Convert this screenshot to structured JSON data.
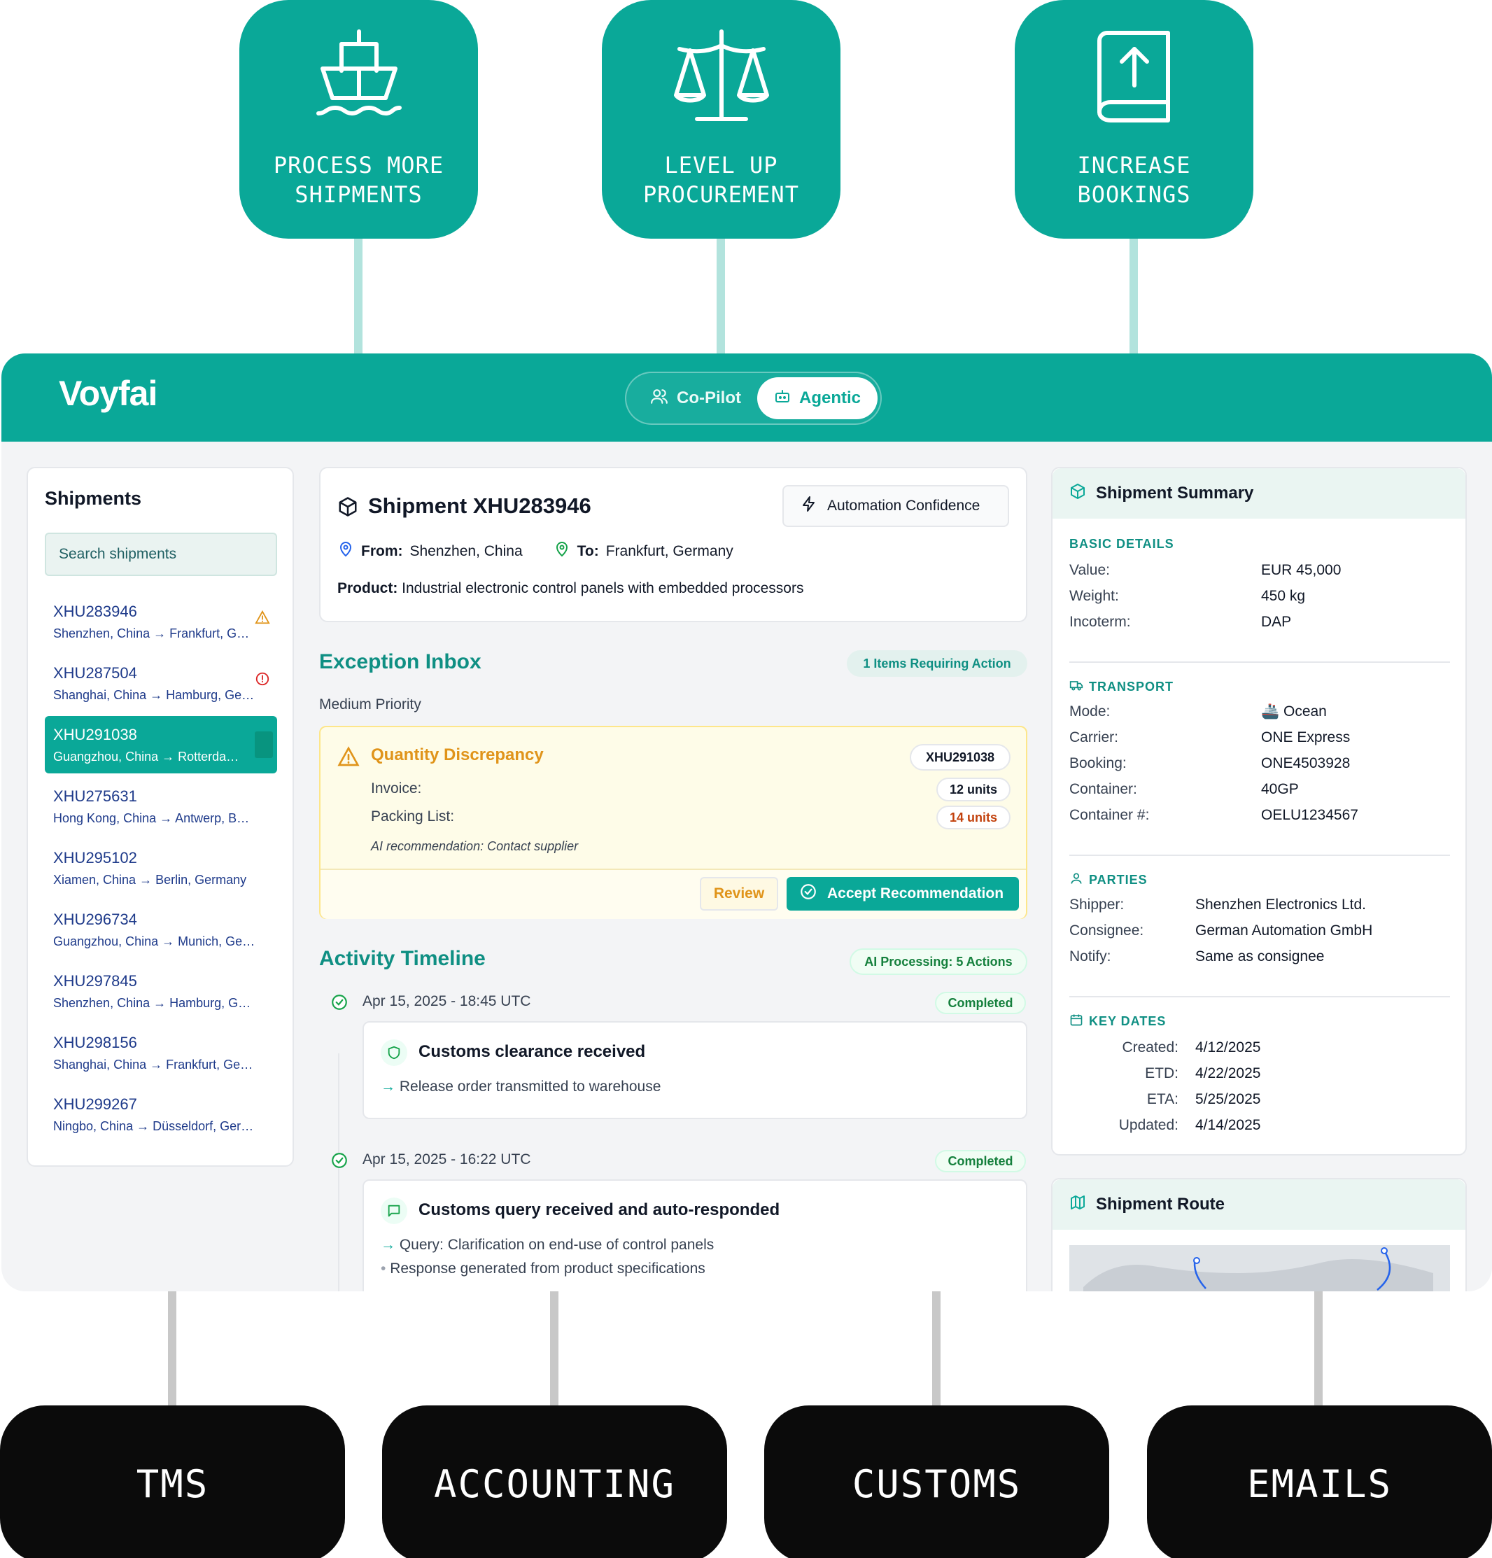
{
  "outcomes": [
    {
      "label": "PROCESS MORE\nSHIPMENTS",
      "icon": "ship-icon"
    },
    {
      "label": "LEVEL UP\nPROCUREMENT",
      "icon": "scales-icon"
    },
    {
      "label": "INCREASE\nBOOKINGS",
      "icon": "book-upload-icon"
    }
  ],
  "app": {
    "logo": "Voyfai",
    "modes": {
      "copilot": "Co-Pilot",
      "agentic": "Agentic",
      "selected": "Agentic"
    }
  },
  "shipments": {
    "title": "Shipments",
    "search_placeholder": "Search shipments",
    "items": [
      {
        "id": "XHU283946",
        "route": "Shenzhen, China → Frankfurt, Germany",
        "flag": "warning"
      },
      {
        "id": "XHU287504",
        "route": "Shanghai, China → Hamburg, Germany",
        "flag": "error"
      },
      {
        "id": "XHU291038",
        "route": "Guangzhou, China → Rotterdam, Netherlands",
        "flag": "selected"
      },
      {
        "id": "XHU275631",
        "route": "Hong Kong, China → Antwerp, Belgium",
        "flag": ""
      },
      {
        "id": "XHU295102",
        "route": "Xiamen, China → Berlin, Germany",
        "flag": ""
      },
      {
        "id": "XHU296734",
        "route": "Guangzhou, China → Munich, Germany",
        "flag": ""
      },
      {
        "id": "XHU297845",
        "route": "Shenzhen, China → Hamburg, Germany",
        "flag": ""
      },
      {
        "id": "XHU298156",
        "route": "Shanghai, China → Frankfurt, Germany",
        "flag": ""
      },
      {
        "id": "XHU299267",
        "route": "Ningbo, China → Düsseldorf, Germany",
        "flag": ""
      }
    ]
  },
  "shipment": {
    "title": "Shipment XHU283946",
    "automation_label": "Automation Confidence",
    "from_label": "From:",
    "from": "Shenzhen, China",
    "to_label": "To:",
    "to": "Frankfurt, Germany",
    "product_label": "Product:",
    "product": "Industrial electronic control panels with embedded processors"
  },
  "exceptions": {
    "title": "Exception Inbox",
    "badge": "1 Items Requiring Action",
    "priority": "Medium Priority",
    "card": {
      "title": "Quantity Discrepancy",
      "shipment_id": "XHU291038",
      "invoice_label": "Invoice:",
      "invoice_value": "12 units",
      "packing_label": "Packing List:",
      "packing_value": "14 units",
      "recommendation": "AI recommendation: Contact supplier",
      "review_label": "Review",
      "accept_label": "Accept Recommendation"
    }
  },
  "timeline": {
    "title": "Activity Timeline",
    "badge": "AI Processing: 5 Actions",
    "events": [
      {
        "time": "Apr 15, 2025 - 18:45 UTC",
        "status": "Completed",
        "title": "Customs clearance received",
        "details": [
          "Release order transmitted to warehouse"
        ],
        "icon": "shield-icon"
      },
      {
        "time": "Apr 15, 2025 - 16:22 UTC",
        "status": "Completed",
        "title": "Customs query received and auto-responded",
        "details": [
          "Query: Clarification on end-use of control panels",
          "Response generated from product specifications"
        ],
        "icon": "chat-icon"
      }
    ]
  },
  "summary": {
    "title": "Shipment Summary",
    "basic": {
      "heading": "BASIC DETAILS",
      "rows": [
        [
          "Value:",
          "EUR 45,000"
        ],
        [
          "Weight:",
          "450 kg"
        ],
        [
          "Incoterm:",
          "DAP"
        ]
      ]
    },
    "transport": {
      "heading": "TRANSPORT",
      "rows": [
        [
          "Mode:",
          "🚢 Ocean"
        ],
        [
          "Carrier:",
          "ONE Express"
        ],
        [
          "Booking:",
          "ONE4503928"
        ],
        [
          "Container:",
          "40GP"
        ],
        [
          "Container #:",
          "OELU1234567"
        ]
      ]
    },
    "parties": {
      "heading": "PARTIES",
      "rows": [
        [
          "Shipper:",
          "Shenzhen Electronics Ltd."
        ],
        [
          "Consignee:",
          "German Automation GmbH"
        ],
        [
          "Notify:",
          "Same as consignee"
        ]
      ]
    },
    "dates": {
      "heading": "KEY DATES",
      "rows": [
        [
          "Created:",
          "4/12/2025"
        ],
        [
          "ETD:",
          "4/22/2025"
        ],
        [
          "ETA:",
          "5/25/2025"
        ],
        [
          "Updated:",
          "4/14/2025"
        ]
      ]
    }
  },
  "route": {
    "title": "Shipment Route"
  },
  "systems": [
    "TMS",
    "ACCOUNTING",
    "CUSTOMS",
    "EMAILS"
  ],
  "colors": {
    "accent": "#0aa898",
    "warning": "#e0941a",
    "error": "#dc2626",
    "dark": "#0b0b0b"
  }
}
